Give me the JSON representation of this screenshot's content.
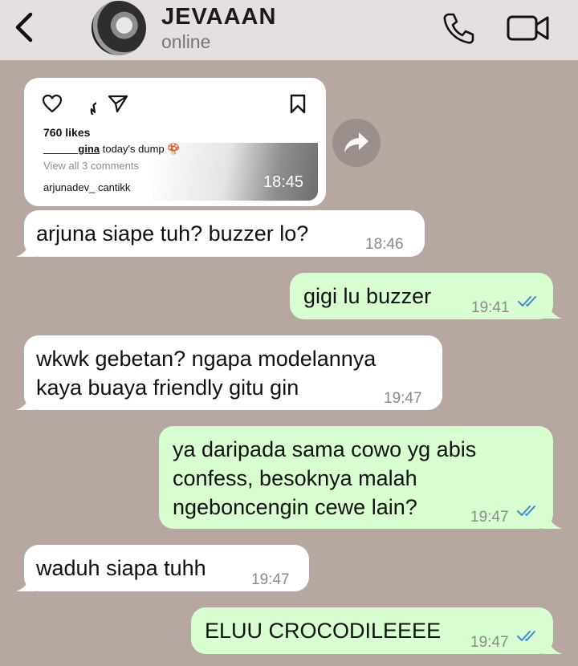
{
  "header": {
    "contact_name": "JEVAAAN",
    "status": "online",
    "icons": [
      "back-chevron-icon",
      "phone-icon",
      "video-camera-icon"
    ]
  },
  "shared_post": {
    "likes": "760 likes",
    "caption_user": "______gina",
    "caption_text": "today's dump 🍄",
    "comments_link": "View all 3 comments",
    "comment": "arjunadev_ cantikk",
    "time": "18:45",
    "icons": [
      "heart-icon",
      "comment-icon",
      "share-icon",
      "bookmark-icon",
      "forward-icon"
    ]
  },
  "messages": [
    {
      "dir": "in",
      "text": "arjuna siape tuh? buzzer lo?",
      "time": "18:46"
    },
    {
      "dir": "out",
      "text": "gigi lu buzzer",
      "time": "19:41",
      "status": "read"
    },
    {
      "dir": "in",
      "text": "wkwk gebetan? ngapa modelannya\nkaya buaya friendly gitu gin",
      "time": "19:47"
    },
    {
      "dir": "out",
      "text": "ya daripada sama cowo yg abis\nconfess, besoknya malah\nngeboncengin cewe lain?",
      "time": "19:47",
      "status": "read"
    },
    {
      "dir": "in",
      "text": "waduh siapa tuhh",
      "time": "19:47"
    },
    {
      "dir": "out",
      "text": "ELUU CROCODILEEEE",
      "time": "19:47",
      "status": "read"
    }
  ],
  "colors": {
    "chat_background": "#b6a7a1",
    "header_background": "#e5dfdf",
    "incoming_bubble": "#ffffff",
    "outgoing_bubble": "#d8fdd0",
    "read_ticks": "#3b8ad8"
  }
}
